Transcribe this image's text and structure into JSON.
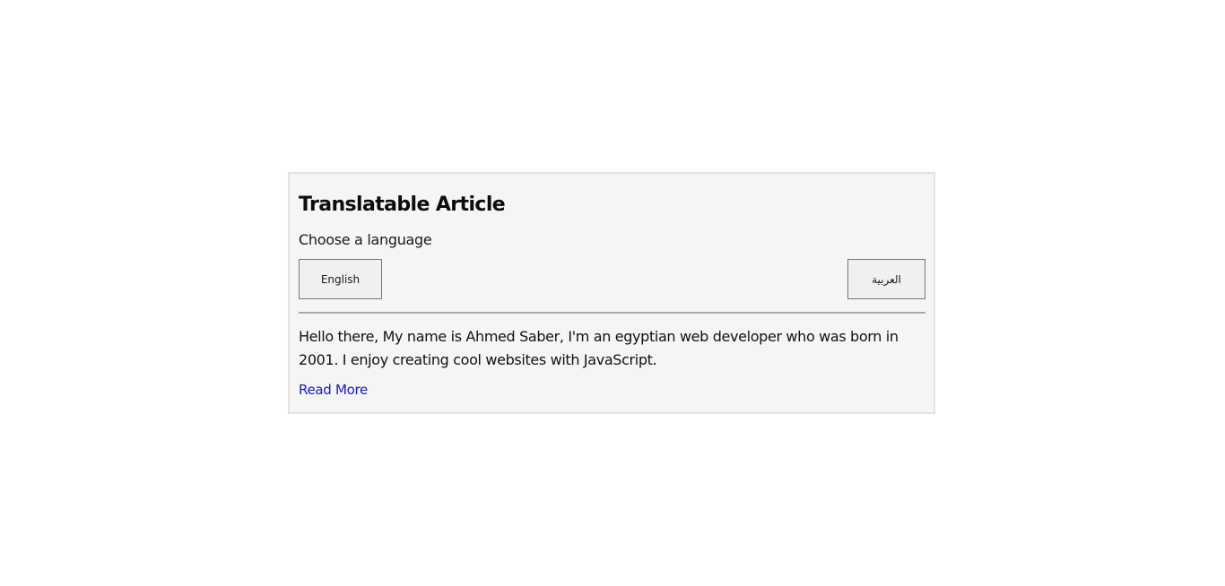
{
  "article": {
    "title": "Translatable Article",
    "subtitle": "Choose a language",
    "buttons": {
      "english": "English",
      "arabic": "العربية"
    },
    "body": "Hello there, My name is Ahmed Saber, I'm an egyptian web developer who was born in 2001. I enjoy creating cool websites with JavaScript.",
    "read_more": "Read More"
  },
  "colors": {
    "card_background": "#f5f5f5",
    "card_border": "#e3e3e3",
    "link": "#1a1ac8"
  }
}
